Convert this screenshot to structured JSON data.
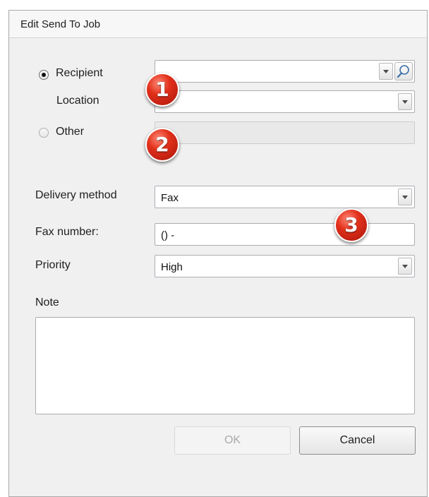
{
  "dialog": {
    "title": "Edit Send To Job"
  },
  "destination": {
    "recipient_label": "Recipient",
    "recipient_value": "",
    "location_label": "Location",
    "location_value": "",
    "other_label": "Other",
    "other_value": "",
    "selected": "Recipient"
  },
  "delivery": {
    "method_label": "Delivery method",
    "method_value": "Fax",
    "fax_label": "Fax number:",
    "fax_value": "() -",
    "priority_label": "Priority",
    "priority_value": "High"
  },
  "note": {
    "label": "Note",
    "value": ""
  },
  "markers": [
    "1",
    "2",
    "3"
  ],
  "buttons": {
    "ok": "OK",
    "cancel": "Cancel"
  },
  "icons": {
    "search": "magnifier-icon",
    "dropdown": "chevron-down-icon"
  },
  "colors": {
    "marker": "#e2311b",
    "dialog_bg": "#f0f0f0",
    "disabled_text": "#a9a9a9"
  }
}
